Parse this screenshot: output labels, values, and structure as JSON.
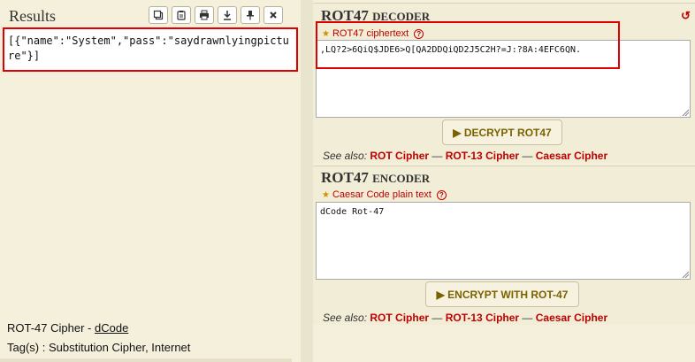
{
  "left": {
    "results_title": "Results",
    "results_text": "[{\"name\":\"System\",\"pass\":\"saydrawnlyingpicture\"}]",
    "tools": [
      {
        "icon": "copy-icon"
      },
      {
        "icon": "clipboard-icon"
      },
      {
        "icon": "print-icon"
      },
      {
        "icon": "download-icon"
      },
      {
        "icon": "pin-icon"
      },
      {
        "icon": "close-icon"
      }
    ],
    "footer_title": "ROT-47 Cipher - ",
    "footer_link": "dCode",
    "footer_tags": "Tag(s) : Substitution Cipher, Internet"
  },
  "decoder": {
    "title_main": "ROT47 ",
    "title_sc": "Decoder",
    "field_label": "ROT47 ciphertext",
    "ciphertext": ",LQ?2>6QiQ$JDE6>Q[QA2DDQiQD2J5C2H?=J:?8A:4EFC6QN.",
    "button": "▶ DECRYPT ROT47",
    "seealso_prefix": "See also: ",
    "links": [
      "ROT Cipher",
      "ROT-13 Cipher",
      "Caesar Cipher"
    ],
    "sep": " — "
  },
  "encoder": {
    "title_main": "ROT47 ",
    "title_sc": "Encoder",
    "field_label": "Caesar Code plain text",
    "plaintext": "dCode Rot-47",
    "button": "▶ ENCRYPT WITH ROT-47",
    "seealso_prefix": "See also: ",
    "links": [
      "ROT Cipher",
      "ROT-13 Cipher",
      "Caesar Cipher"
    ],
    "sep": " — "
  },
  "colors": {
    "highlight": "#e00000",
    "link_red": "#c00000",
    "button_text": "#7a6200",
    "panel_bg": "#f4f0dc"
  }
}
